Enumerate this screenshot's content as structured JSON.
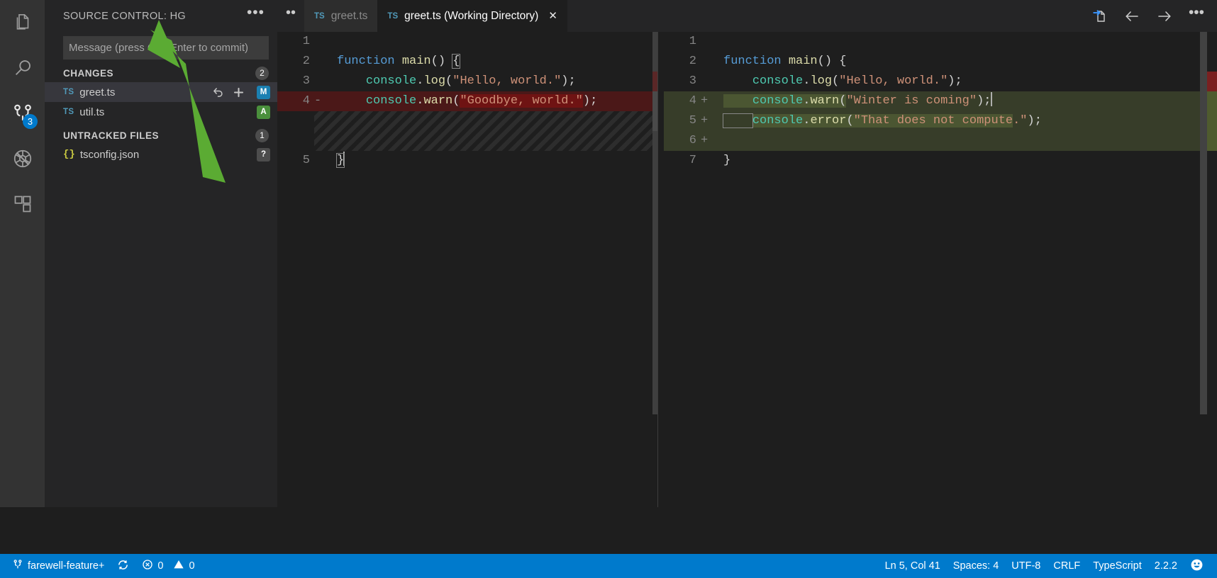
{
  "activity_bar": {
    "items": [
      {
        "name": "explorer",
        "icon": "files-icon",
        "badge": ""
      },
      {
        "name": "search",
        "icon": "search-icon",
        "badge": ""
      },
      {
        "name": "source-control",
        "icon": "source-control-icon",
        "badge": "3"
      },
      {
        "name": "run-and-debug",
        "icon": "debug-disabled-icon",
        "badge": ""
      },
      {
        "name": "extensions",
        "icon": "extensions-icon",
        "badge": ""
      }
    ]
  },
  "sidebar": {
    "title": "SOURCE CONTROL: HG",
    "more_actions_label": "•••",
    "commit_input": {
      "value": "",
      "placeholder": "Message (press Ctrl+Enter to commit)"
    },
    "groups": [
      {
        "label": "CHANGES",
        "count": "2",
        "rows": [
          {
            "icon": "ts-file-icon",
            "icon_label": "TS",
            "name": "greet.ts",
            "selected": true,
            "actions": [
              "discard-changes-icon",
              "stage-changes-icon"
            ],
            "status": "M",
            "status_color": "#1b80b2"
          },
          {
            "icon": "ts-file-icon",
            "icon_label": "TS",
            "name": "util.ts",
            "selected": false,
            "actions": [],
            "status": "A",
            "status_color": "#4a8f3c"
          }
        ]
      },
      {
        "label": "UNTRACKED FILES",
        "count": "1",
        "rows": [
          {
            "icon": "json-file-icon",
            "icon_label": "{}",
            "name": "tsconfig.json",
            "selected": false,
            "actions": [],
            "status": "?",
            "status_color": "#4d4d4d"
          }
        ]
      }
    ]
  },
  "tab_bar": {
    "overflow_label": "••",
    "tabs": [
      {
        "icon_label": "TS",
        "label": "greet.ts",
        "active": false,
        "closable": false
      },
      {
        "icon_label": "TS",
        "label": "greet.ts (Working Directory)",
        "active": true,
        "closable": true,
        "close_label": "✕"
      }
    ],
    "toolbar": [
      {
        "name": "switch-to-file-icon"
      },
      {
        "name": "back-arrow-icon"
      },
      {
        "name": "forward-arrow-icon"
      },
      {
        "name": "more-actions-icon",
        "label": "•••"
      }
    ]
  },
  "diff": {
    "left": {
      "lines": [
        {
          "num": "1",
          "sign": "",
          "type": "context",
          "text": ""
        },
        {
          "num": "2",
          "sign": "",
          "type": "context",
          "segments": [
            {
              "t": "function ",
              "c": "tok-kw"
            },
            {
              "t": "main",
              "c": "tok-fn"
            },
            {
              "t": "() ",
              "c": "tok-br"
            },
            {
              "t": "{",
              "c": "tok-br bracket-box"
            }
          ]
        },
        {
          "num": "3",
          "sign": "",
          "type": "context",
          "segments": [
            {
              "t": "    ",
              "c": "tok-pl"
            },
            {
              "t": "console",
              "c": "tok-obj"
            },
            {
              "t": ".",
              "c": "tok-pl"
            },
            {
              "t": "log",
              "c": "tok-fn"
            },
            {
              "t": "(",
              "c": "tok-br"
            },
            {
              "t": "\"Hello, world.\"",
              "c": "tok-str"
            },
            {
              "t": ");",
              "c": "tok-br"
            }
          ]
        },
        {
          "num": "4",
          "sign": "-",
          "type": "deleted",
          "segments": [
            {
              "t": "    ",
              "c": "tok-pl"
            },
            {
              "t": "console",
              "c": "tok-obj"
            },
            {
              "t": ".",
              "c": "tok-pl"
            },
            {
              "t": "warn",
              "c": "tok-fn"
            },
            {
              "t": "(",
              "c": "tok-br"
            },
            {
              "t": "\"Goodbye, world.\"",
              "c": "tok-str chunk-del"
            },
            {
              "t": ");",
              "c": "tok-br"
            }
          ]
        },
        {
          "num": "",
          "sign": "",
          "type": "filler",
          "text": ""
        },
        {
          "num": "5",
          "sign": "",
          "type": "context",
          "segments": [
            {
              "t": "}",
              "c": "tok-br bracket-box"
            }
          ],
          "cursor_after": true
        }
      ]
    },
    "right": {
      "lines": [
        {
          "num": "1",
          "sign": "",
          "type": "context",
          "text": ""
        },
        {
          "num": "2",
          "sign": "",
          "type": "context",
          "segments": [
            {
              "t": "function ",
              "c": "tok-kw"
            },
            {
              "t": "main",
              "c": "tok-fn"
            },
            {
              "t": "() {",
              "c": "tok-br"
            }
          ]
        },
        {
          "num": "3",
          "sign": "",
          "type": "context",
          "segments": [
            {
              "t": "    ",
              "c": "tok-pl"
            },
            {
              "t": "console",
              "c": "tok-obj"
            },
            {
              "t": ".",
              "c": "tok-pl"
            },
            {
              "t": "log",
              "c": "tok-fn"
            },
            {
              "t": "(",
              "c": "tok-br"
            },
            {
              "t": "\"Hello, world.\"",
              "c": "tok-str"
            },
            {
              "t": ");",
              "c": "tok-br"
            }
          ]
        },
        {
          "num": "4",
          "sign": "+",
          "type": "added",
          "segments": [
            {
              "t": "    ",
              "c": "tok-pl chunk-add"
            },
            {
              "t": "console",
              "c": "tok-obj chunk-add"
            },
            {
              "t": ".",
              "c": "tok-pl chunk-add"
            },
            {
              "t": "warn",
              "c": "tok-fn chunk-add"
            },
            {
              "t": "(",
              "c": "tok-br chunk-add"
            },
            {
              "t": "\"Winter is coming\"",
              "c": "tok-str"
            },
            {
              "t": ");",
              "c": "tok-br"
            }
          ]
        },
        {
          "num": "5",
          "sign": "+",
          "type": "added",
          "segments": [
            {
              "t": "    ",
              "c": "tok-pl bracket-box"
            },
            {
              "t": "console",
              "c": "tok-obj chunk-add"
            },
            {
              "t": ".",
              "c": "tok-pl chunk-add"
            },
            {
              "t": "error",
              "c": "tok-fn chunk-add"
            },
            {
              "t": "(",
              "c": "tok-br chunk-add"
            },
            {
              "t": "\"That does not compute",
              "c": "tok-str chunk-add"
            },
            {
              "t": ".\"",
              "c": "tok-str"
            },
            {
              "t": ");",
              "c": "tok-br"
            }
          ]
        },
        {
          "num": "6",
          "sign": "+",
          "type": "added",
          "text": ""
        },
        {
          "num": "7",
          "sign": "",
          "type": "context",
          "segments": [
            {
              "t": "}",
              "c": "tok-br"
            }
          ]
        }
      ]
    }
  },
  "status_bar": {
    "left": [
      {
        "name": "branch",
        "icon": "source-control-branch-icon",
        "label": "farewell-feature+"
      },
      {
        "name": "sync",
        "icon": "sync-icon",
        "label": ""
      },
      {
        "name": "errors",
        "icon": "error-icon",
        "label": "0"
      },
      {
        "name": "warnings",
        "icon": "warning-icon",
        "label": "0"
      }
    ],
    "right": [
      {
        "name": "cursor-position",
        "label": "Ln 5, Col 41"
      },
      {
        "name": "indentation",
        "label": "Spaces: 4"
      },
      {
        "name": "encoding",
        "label": "UTF-8"
      },
      {
        "name": "line-endings",
        "label": "CRLF"
      },
      {
        "name": "language-mode",
        "label": "TypeScript"
      },
      {
        "name": "typescript-version",
        "label": "2.2.2"
      },
      {
        "name": "feedback",
        "icon": "smiley-icon",
        "label": ""
      }
    ]
  },
  "annotation": {
    "arrow_color": "#5bab33",
    "points_to": "SOURCE CONTROL: HG"
  }
}
